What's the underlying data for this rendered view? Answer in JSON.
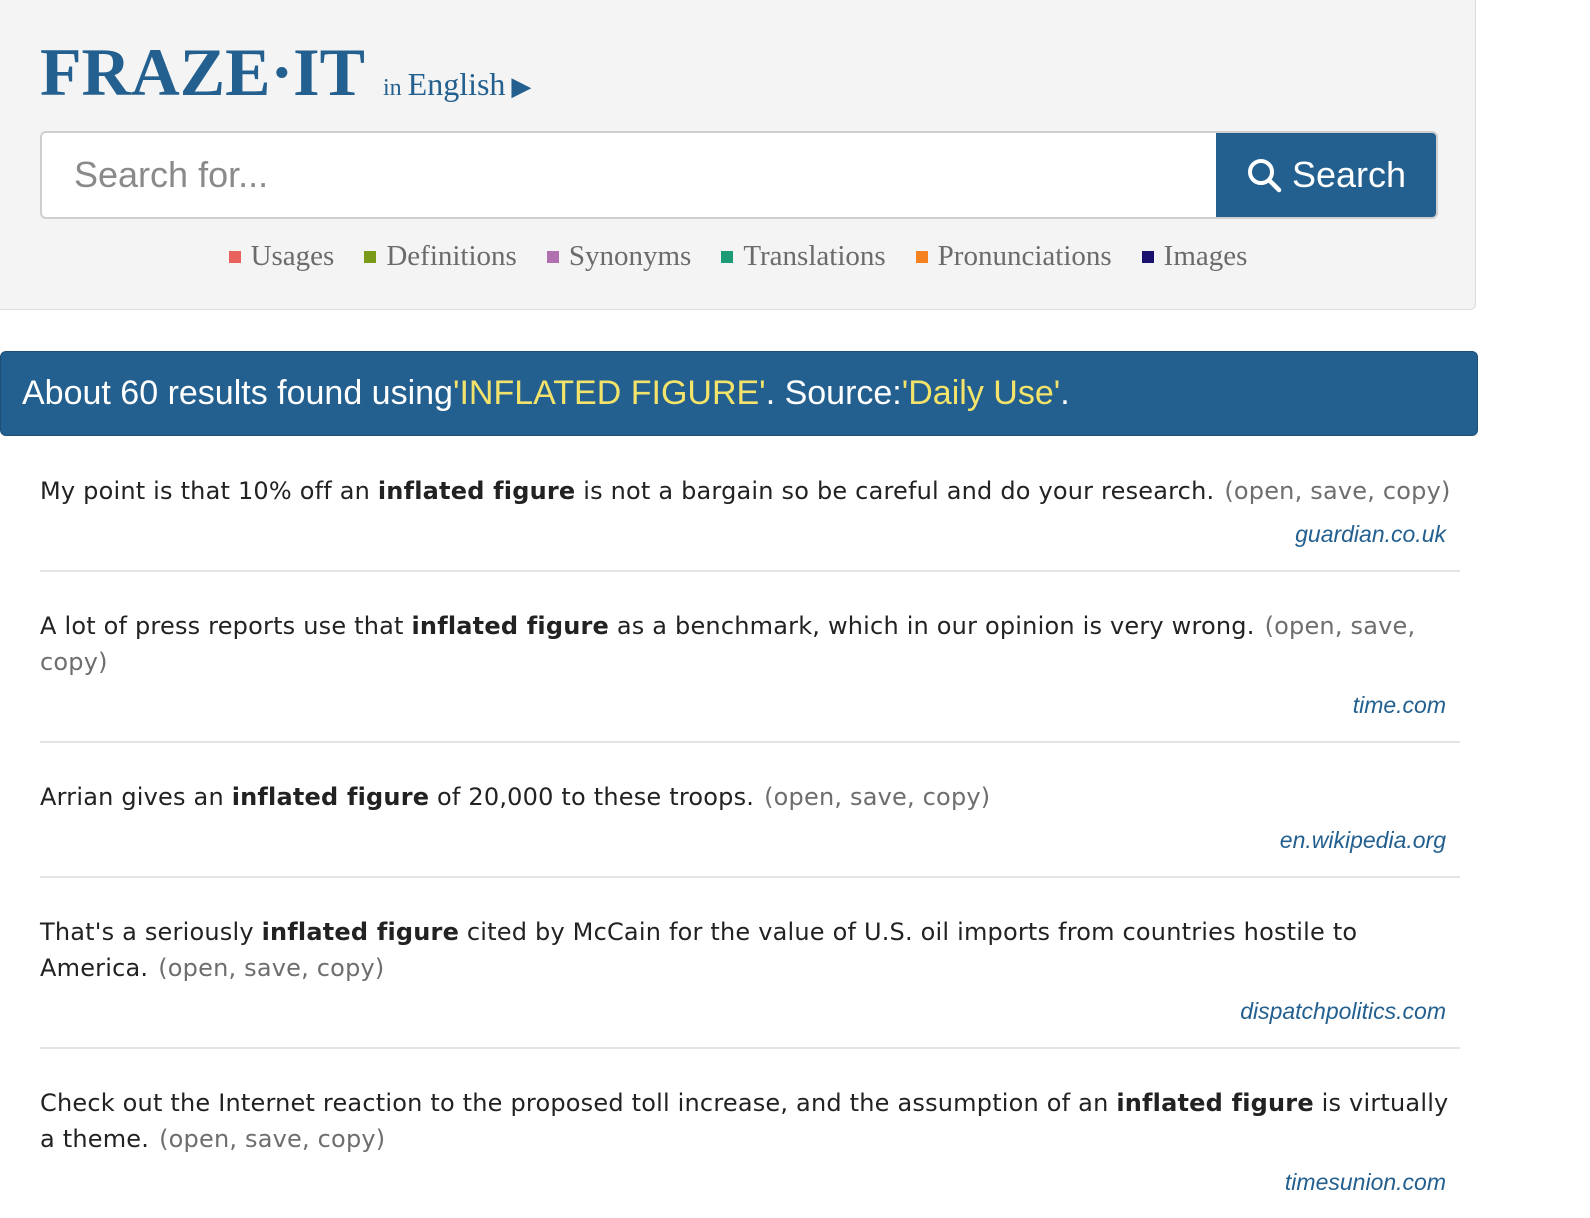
{
  "header": {
    "logo": "FRAZE·IT",
    "lang_prefix": "in",
    "lang_name": "English",
    "lang_arrow": "▶",
    "search": {
      "placeholder": "Search for...",
      "button_label": "Search"
    },
    "categories": [
      {
        "label": "Usages",
        "color": "#e8615d"
      },
      {
        "label": "Definitions",
        "color": "#7a9a1a"
      },
      {
        "label": "Synonyms",
        "color": "#b070b0"
      },
      {
        "label": "Translations",
        "color": "#1d9a76"
      },
      {
        "label": "Pronunciations",
        "color": "#f58220"
      },
      {
        "label": "Images",
        "color": "#1a1070"
      }
    ]
  },
  "banner": {
    "prefix": "About 60 results found using ",
    "query": "'INFLATED FIGURE'",
    "middle": ". Source: ",
    "source": "'Daily Use'",
    "suffix": "."
  },
  "results": [
    {
      "before": "My point is that 10% off an ",
      "term": "inflated figure",
      "after": " is not a bargain so be careful and do your research.",
      "actions": "(open, save, copy)",
      "source": "guardian.co.uk"
    },
    {
      "before": "A lot of press reports use that ",
      "term": "inflated figure",
      "after": " as a benchmark, which in our opinion is very wrong.",
      "actions": "(open, save, copy)",
      "source": "time.com"
    },
    {
      "before": "Arrian gives an ",
      "term": "inflated figure",
      "after": " of 20,000 to these troops.",
      "actions": "(open, save, copy)",
      "source": "en.wikipedia.org"
    },
    {
      "before": "That's a seriously ",
      "term": "inflated figure",
      "after": " cited by McCain for the value of U.S. oil imports from countries hostile to America.",
      "actions": "(open, save, copy)",
      "source": "dispatchpolitics.com"
    },
    {
      "before": "Check out the Internet reaction to the proposed toll increase, and the assumption of an ",
      "term": "inflated figure",
      "after": " is virtually a theme.",
      "actions": "(open, save, copy)",
      "source": "timesunion.com"
    }
  ]
}
